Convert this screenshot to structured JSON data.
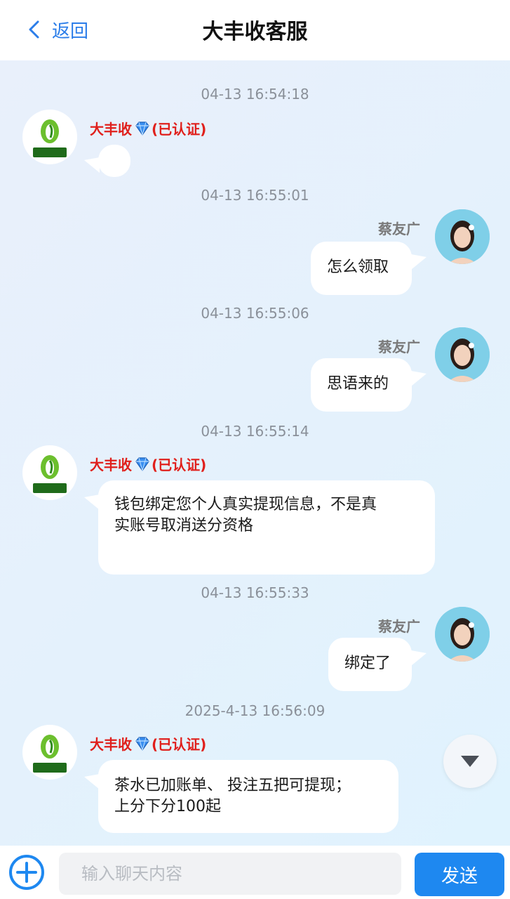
{
  "header": {
    "back_label": "返回",
    "title": "大丰收客服"
  },
  "brand": {
    "logo_text": "大丰收",
    "badge": "(已认证)",
    "accent_color": "#e0201c"
  },
  "messages": [
    {
      "time": "04-13 16:54:18",
      "sender": "大丰收",
      "text": ""
    },
    {
      "time": "04-13 16:55:01",
      "sender": "蔡友广",
      "text": "怎么领取"
    },
    {
      "time": "04-13 16:55:06",
      "sender": "蔡友广",
      "text": "思语来的"
    },
    {
      "time": "04-13 16:55:14",
      "sender": "大丰收",
      "text_lines": [
        "钱包绑定您个人真实提现信息，不是真",
        "实账号取消送分资格"
      ]
    },
    {
      "time": "04-13 16:55:33",
      "sender": "蔡友广",
      "text": "绑定了"
    },
    {
      "time": "2025-4-13 16:56:09",
      "sender": "大丰收",
      "text_lines": [
        "茶水已加账单、 投注五把可提现；",
        "上分下分100起"
      ]
    }
  ],
  "composer": {
    "placeholder": "输入聊天内容",
    "send_label": "发送"
  }
}
